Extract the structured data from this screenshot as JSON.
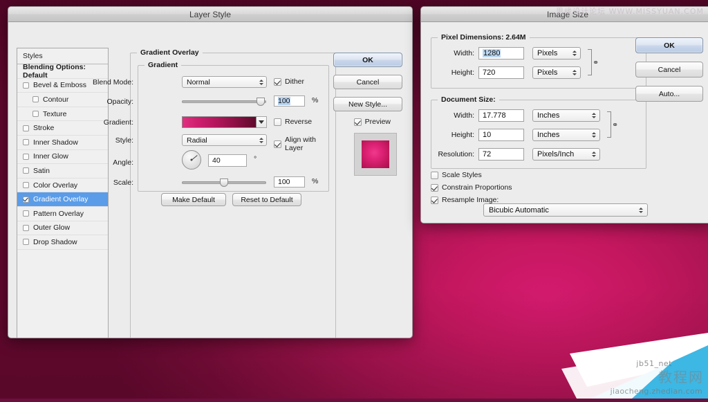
{
  "watermarks": {
    "top": "思缘设计论坛  WWW.MISSYUAN.COM",
    "jb51": "jb51_net",
    "cn": "教程网",
    "url": "jiaocheng.zhedian.com"
  },
  "layer_style": {
    "title": "Layer Style",
    "styles_panel": {
      "header": "Styles",
      "blending": "Blending Options: Default",
      "items": [
        {
          "label": "Bevel & Emboss",
          "checked": false,
          "indent": false,
          "selected": false
        },
        {
          "label": "Contour",
          "checked": false,
          "indent": true,
          "selected": false
        },
        {
          "label": "Texture",
          "checked": false,
          "indent": true,
          "selected": false
        },
        {
          "label": "Stroke",
          "checked": false,
          "indent": false,
          "selected": false
        },
        {
          "label": "Inner Shadow",
          "checked": false,
          "indent": false,
          "selected": false
        },
        {
          "label": "Inner Glow",
          "checked": false,
          "indent": false,
          "selected": false
        },
        {
          "label": "Satin",
          "checked": false,
          "indent": false,
          "selected": false
        },
        {
          "label": "Color Overlay",
          "checked": false,
          "indent": false,
          "selected": false
        },
        {
          "label": "Gradient Overlay",
          "checked": true,
          "indent": false,
          "selected": true
        },
        {
          "label": "Pattern Overlay",
          "checked": false,
          "indent": false,
          "selected": false
        },
        {
          "label": "Outer Glow",
          "checked": false,
          "indent": false,
          "selected": false
        },
        {
          "label": "Drop Shadow",
          "checked": false,
          "indent": false,
          "selected": false
        }
      ]
    },
    "panel": {
      "group_title": "Gradient Overlay",
      "inner_title": "Gradient",
      "blend_mode_label": "Blend Mode:",
      "blend_mode_value": "Normal",
      "dither_label": "Dither",
      "dither_checked": true,
      "opacity_label": "Opacity:",
      "opacity_value": "100",
      "opacity_unit": "%",
      "gradient_label": "Gradient:",
      "gradient_colors": "#e0307f to #5e0a2c",
      "reverse_label": "Reverse",
      "reverse_checked": false,
      "style_label": "Style:",
      "style_value": "Radial",
      "align_label": "Align with Layer",
      "align_checked": true,
      "angle_label": "Angle:",
      "angle_value": "40",
      "angle_unit": "°",
      "scale_label": "Scale:",
      "scale_value": "100",
      "scale_unit": "%",
      "make_default": "Make Default",
      "reset_default": "Reset to Default"
    },
    "buttons": {
      "ok": "OK",
      "cancel": "Cancel",
      "new_style": "New Style...",
      "preview_label": "Preview",
      "preview_checked": true
    }
  },
  "image_size": {
    "title": "Image Size",
    "pixel_dimensions": {
      "group_label": "Pixel Dimensions:  2.64M",
      "width_label": "Width:",
      "width_value": "1280",
      "width_unit": "Pixels",
      "height_label": "Height:",
      "height_value": "720",
      "height_unit": "Pixels"
    },
    "document_size": {
      "group_label": "Document Size:",
      "width_label": "Width:",
      "width_value": "17.778",
      "width_unit": "Inches",
      "height_label": "Height:",
      "height_value": "10",
      "height_unit": "Inches",
      "resolution_label": "Resolution:",
      "resolution_value": "72",
      "resolution_unit": "Pixels/Inch"
    },
    "options": {
      "scale_styles": "Scale Styles",
      "scale_styles_checked": false,
      "constrain": "Constrain Proportions",
      "constrain_checked": true,
      "resample": "Resample Image:",
      "resample_checked": true,
      "resample_method": "Bicubic Automatic"
    },
    "buttons": {
      "ok": "OK",
      "cancel": "Cancel",
      "auto": "Auto..."
    }
  }
}
